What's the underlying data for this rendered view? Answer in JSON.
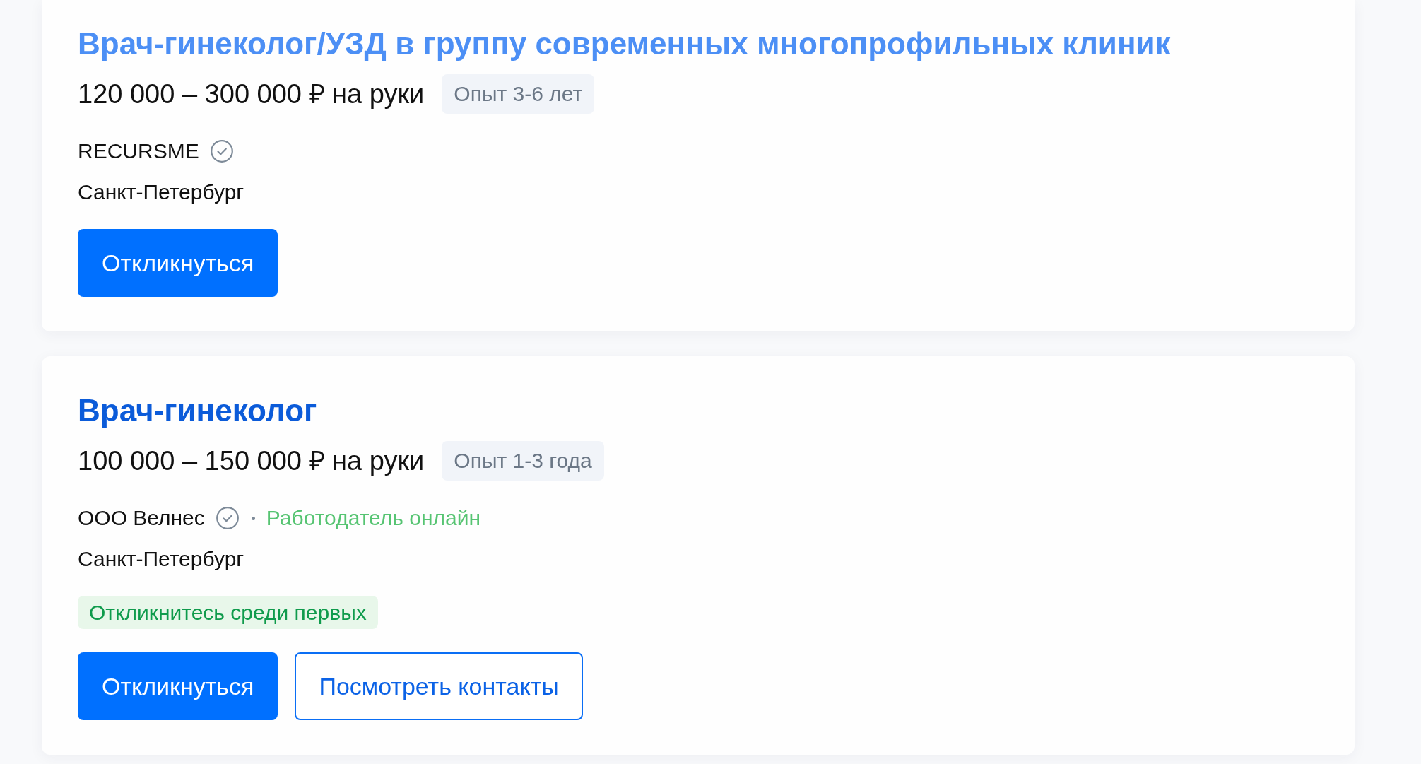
{
  "vacancies": [
    {
      "title": "Врач-гинеколог/УЗД в группу современных многопрофильных клиник",
      "visited": true,
      "salary": "120 000 – 300 000 ₽ на руки",
      "experience": "Опыт 3-6 лет",
      "company": "RECURSME",
      "verified": true,
      "location": "Санкт-Петербург",
      "buttons": [
        {
          "kind": "primary",
          "label": "Откликнуться"
        }
      ]
    },
    {
      "title": "Врач-гинеколог",
      "visited": false,
      "salary": "100 000 – 150 000 ₽ на руки",
      "experience": "Опыт 1-3 года",
      "company": "ООО Велнес",
      "verified": true,
      "employer_status": "Работодатель онлайн",
      "location": "Санкт-Петербург",
      "promo": "Откликнитесь среди первых",
      "buttons": [
        {
          "kind": "primary",
          "label": "Откликнуться"
        },
        {
          "kind": "outline",
          "label": "Посмотреть контакты"
        }
      ]
    }
  ]
}
